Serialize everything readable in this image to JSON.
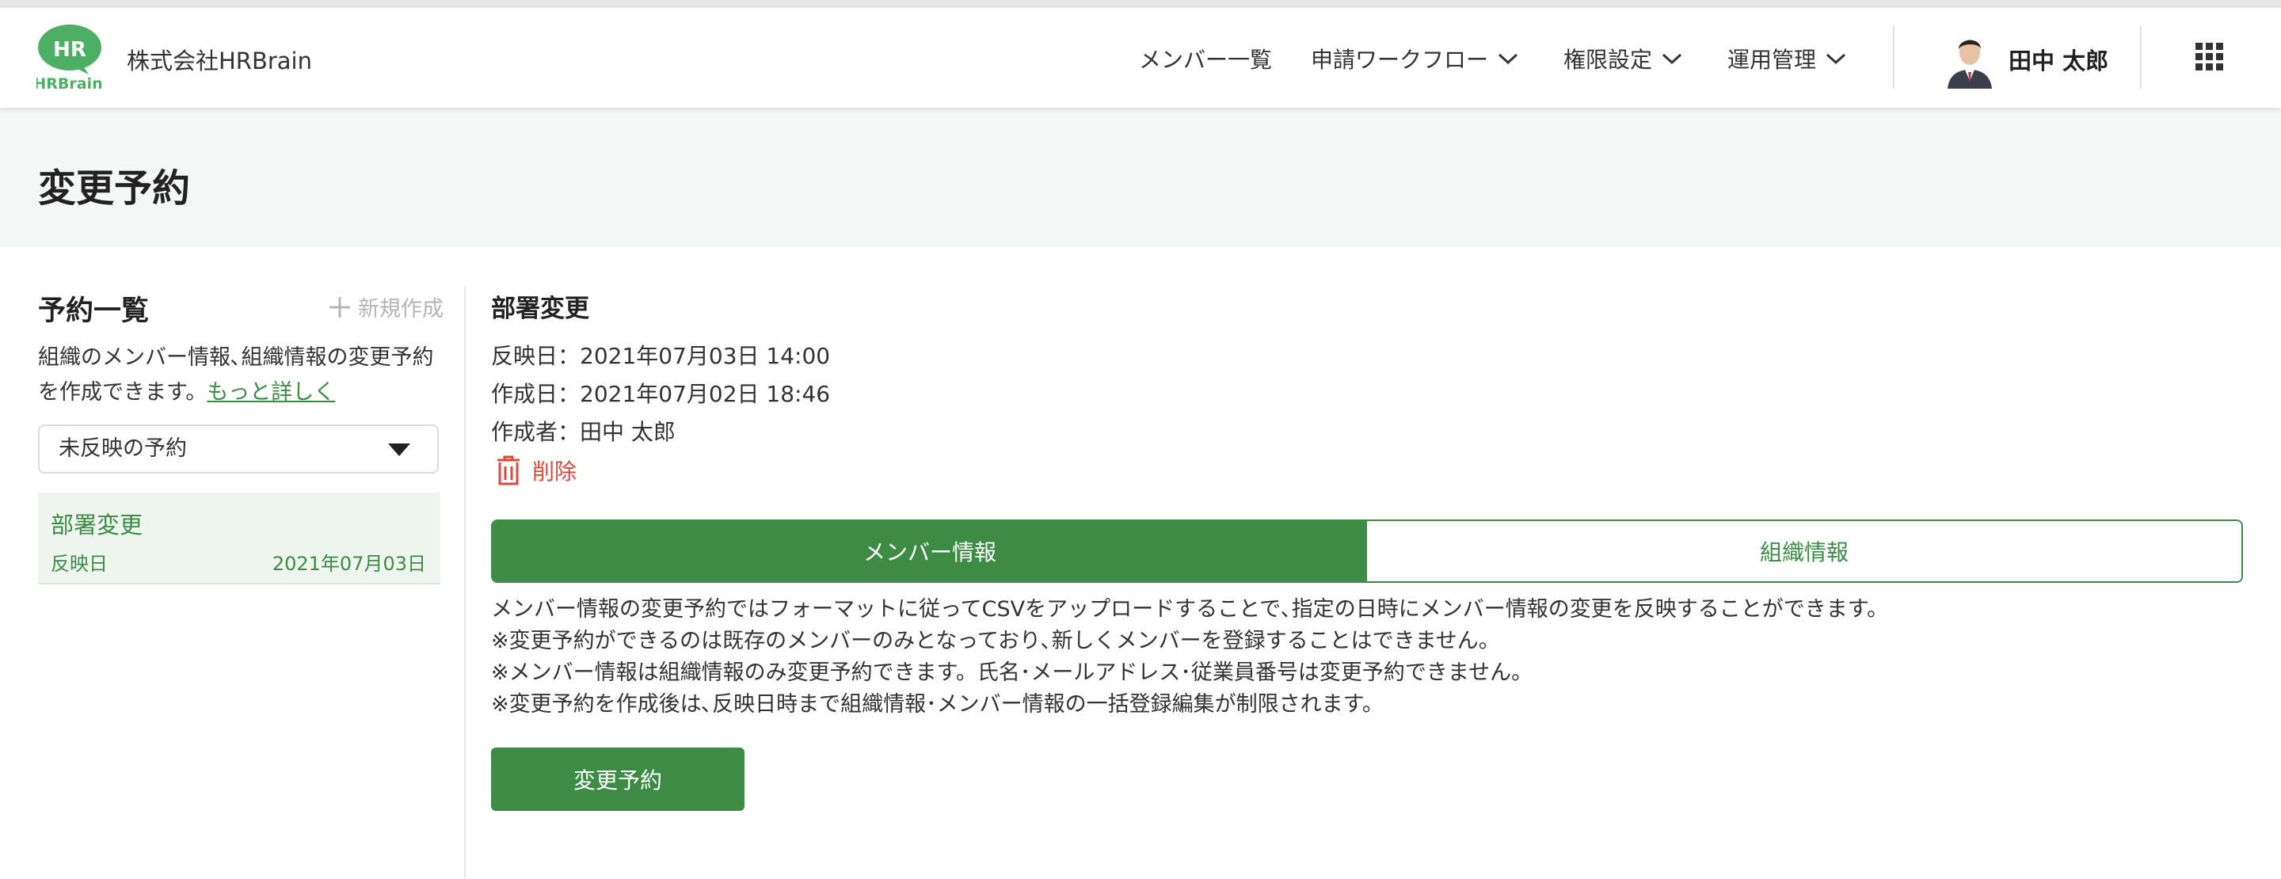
{
  "header": {
    "logo_top": "HR",
    "logo_bottom": "HRBrain",
    "company": "株式会社HRBrain",
    "nav": [
      {
        "label": "メンバー一覧",
        "dropdown": false
      },
      {
        "label": "申請ワークフロー",
        "dropdown": true
      },
      {
        "label": "権限設定",
        "dropdown": true
      },
      {
        "label": "運用管理",
        "dropdown": true
      }
    ],
    "user_name": "田中 太郎",
    "icons": {
      "apps": "grid-apps-icon",
      "avatar": "user-avatar"
    }
  },
  "page": {
    "title": "変更予約"
  },
  "sidebar": {
    "title": "予約一覧",
    "new_button": "新規作成",
    "description": "組織のメンバー情報､組織情報の変更予約を作成できます。",
    "more_link": "もっと詳しく",
    "filter": {
      "selected": "未反映の予約"
    },
    "items": [
      {
        "title": "部署変更",
        "label": "反映日",
        "date": "2021年07月03日"
      }
    ]
  },
  "detail": {
    "title": "部署変更",
    "reflect_date": "反映日：2021年07月03日 14:00",
    "created_date": "作成日：2021年07月02日 18:46",
    "author": "作成者：田中 太郎",
    "delete_label": "削除",
    "tabs": [
      {
        "label": "メンバー情報",
        "active": true
      },
      {
        "label": "組織情報",
        "active": false
      }
    ],
    "notes": [
      "メンバー情報の変更予約ではフォーマットに従ってCSVをアップロードすることで､指定の日時にメンバー情報の変更を反映することができます。",
      "※変更予約ができるのは既存のメンバーのみとなっており､新しくメンバーを登録することはできません。",
      "※メンバー情報は組織情報のみ変更予約できます。氏名･メールアドレス･従業員番号は変更予約できません。",
      "※変更予約を作成後は､反映日時まで組織情報･メンバー情報の一括登録編集が制限されます。"
    ],
    "submit_label": "変更予約"
  },
  "colors": {
    "brand_green": "#3d8b45",
    "logo_green": "#4caf63",
    "danger": "#d94a38",
    "page_bg": "#f5f7f6"
  }
}
